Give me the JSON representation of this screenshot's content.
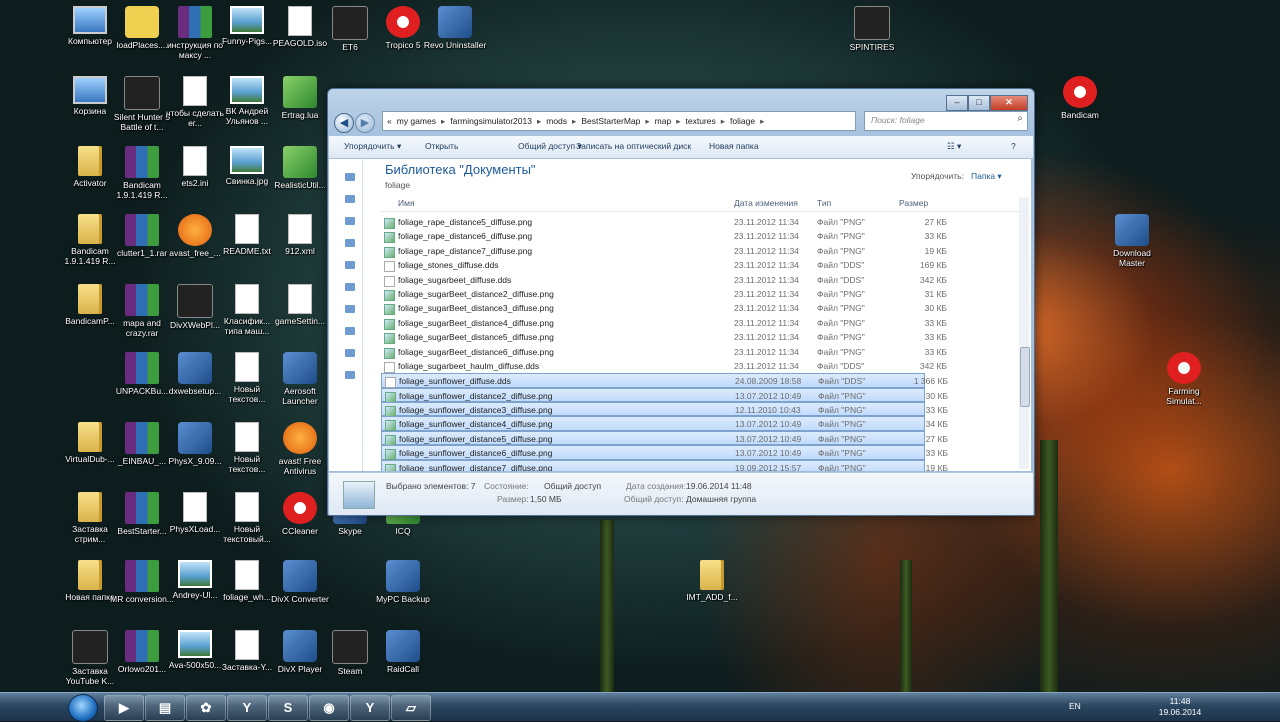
{
  "desktop_icons": [
    {
      "label": "Компьютер",
      "glyph": "comp"
    },
    {
      "label": "loadPlaces....",
      "glyph": "yellow"
    },
    {
      "label": "инструкция по максу ...",
      "glyph": "rar"
    },
    {
      "label": "Funny-Pigs...",
      "glyph": "img"
    },
    {
      "label": "PEAGOLD.iso",
      "glyph": "doc"
    },
    {
      "label": "ET6",
      "glyph": "dark"
    },
    {
      "label": "Tropico 5",
      "glyph": "red"
    },
    {
      "label": "Revo Uninstaller",
      "glyph": "app"
    },
    {
      "label": "SPINTIRES",
      "glyph": "dark"
    },
    {
      "label": "Корзина",
      "glyph": "comp"
    },
    {
      "label": "Silent Hunter 5 Battle of t...",
      "glyph": "dark"
    },
    {
      "label": "чтобы сделать ег...",
      "glyph": "doc"
    },
    {
      "label": "ВК Андрей Ульянов ...",
      "glyph": "img"
    },
    {
      "label": "Ertrag.lua",
      "glyph": "green"
    },
    {
      "label": "Bandicam",
      "glyph": "red"
    },
    {
      "label": "Activator",
      "glyph": "folder"
    },
    {
      "label": "Bandicam 1.9.1.419 R...",
      "glyph": "rar"
    },
    {
      "label": "ets2.ini",
      "glyph": "doc"
    },
    {
      "label": "Свинка.jpg",
      "glyph": "img"
    },
    {
      "label": "RealisticUtil...",
      "glyph": "green"
    },
    {
      "label": "Bandicam 1.9.1.419 R...",
      "glyph": "folder"
    },
    {
      "label": "clutter1_1.rar",
      "glyph": "rar"
    },
    {
      "label": "avast_free_...",
      "glyph": "orange"
    },
    {
      "label": "README.txt",
      "glyph": "doc"
    },
    {
      "label": "912.xml",
      "glyph": "doc"
    },
    {
      "label": "Download Master",
      "glyph": "app"
    },
    {
      "label": "BandicamP...",
      "glyph": "folder"
    },
    {
      "label": "mapa and crazy.rar",
      "glyph": "rar"
    },
    {
      "label": "DivXWebPl...",
      "glyph": "dark"
    },
    {
      "label": "Класифик... типа маш...",
      "glyph": "doc"
    },
    {
      "label": "gameSettin...",
      "glyph": "doc"
    },
    {
      "label": "UNPACKBu...",
      "glyph": "rar"
    },
    {
      "label": "dxwebsetup...",
      "glyph": "app"
    },
    {
      "label": "Новый текстов...",
      "glyph": "doc"
    },
    {
      "label": "Aerosoft Launcher",
      "glyph": "app"
    },
    {
      "label": "Farming Simulat...",
      "glyph": "red"
    },
    {
      "label": "VirtualDub-...",
      "glyph": "folder"
    },
    {
      "label": "_EINBAU_...",
      "glyph": "rar"
    },
    {
      "label": "PhysX_9.09...",
      "glyph": "app"
    },
    {
      "label": "Новый текстов...",
      "glyph": "doc"
    },
    {
      "label": "avast! Free Antivirus",
      "glyph": "orange"
    },
    {
      "label": "Заставка стрим...",
      "glyph": "folder"
    },
    {
      "label": "BestStarter...",
      "glyph": "rar"
    },
    {
      "label": "PhysXLoad...",
      "glyph": "doc"
    },
    {
      "label": "Новый текстовый...",
      "glyph": "doc"
    },
    {
      "label": "CCleaner",
      "glyph": "red"
    },
    {
      "label": "Skype",
      "glyph": "app"
    },
    {
      "label": "ICQ",
      "glyph": "green"
    },
    {
      "label": "Новая папка",
      "glyph": "folder"
    },
    {
      "label": "MR conversion...",
      "glyph": "rar"
    },
    {
      "label": "Andrey-Ul...",
      "glyph": "img"
    },
    {
      "label": "foliage_wh...",
      "glyph": "doc"
    },
    {
      "label": "DivX Converter",
      "glyph": "app"
    },
    {
      "label": "MyPC Backup",
      "glyph": "app"
    },
    {
      "label": "IMT_ADD_f...",
      "glyph": "folder"
    },
    {
      "label": "Заставка YouTube K...",
      "glyph": "dark"
    },
    {
      "label": "Orlowo201...",
      "glyph": "rar"
    },
    {
      "label": "Ava-500x50...",
      "glyph": "img"
    },
    {
      "label": "Заставка-Y...",
      "glyph": "doc"
    },
    {
      "label": "DivX Player",
      "glyph": "app"
    },
    {
      "label": "Steam",
      "glyph": "dark"
    },
    {
      "label": "RaidCall",
      "glyph": "app"
    }
  ],
  "explorer": {
    "back_glyph": "◀",
    "fwd_glyph": "▶",
    "address": {
      "prefix": "«",
      "parts": [
        "my games",
        "farmingsimulator2013",
        "mods",
        "BestStarterMap",
        "map",
        "textures",
        "foliage"
      ],
      "sep": "▸"
    },
    "refresh_glyph": "⟳",
    "search_placeholder": "Поиск: foliage",
    "search_glyph": "⌕",
    "caption_buttons": {
      "min": "–",
      "max": "□",
      "close": "✕"
    },
    "toolbar": {
      "organize": "Упорядочить ▾",
      "open": "Открыть",
      "share": "Общий доступ ▾",
      "burn": "Записать на оптический диск",
      "new_folder": "Новая папка",
      "view": "☷ ▾",
      "help": "?"
    },
    "library_title": "Библиотека \"Документы\"",
    "library_sub": "foliage",
    "arrange_label": "Упорядочить:",
    "arrange_value": "Папка ▾",
    "columns": {
      "name": "Имя",
      "date": "Дата изменения",
      "type": "Тип",
      "size": "Размер"
    },
    "files": [
      {
        "name": "foliage_rape_distance5_diffuse.png",
        "date": "23.11.2012 11:34",
        "type": "Файл \"PNG\"",
        "size": "27 КБ",
        "kind": "png",
        "selected": false
      },
      {
        "name": "foliage_rape_distance6_diffuse.png",
        "date": "23.11.2012 11:34",
        "type": "Файл \"PNG\"",
        "size": "33 КБ",
        "kind": "png",
        "selected": false
      },
      {
        "name": "foliage_rape_distance7_diffuse.png",
        "date": "23.11.2012 11:34",
        "type": "Файл \"PNG\"",
        "size": "19 КБ",
        "kind": "png",
        "selected": false
      },
      {
        "name": "foliage_stones_diffuse.dds",
        "date": "23.11.2012 11:34",
        "type": "Файл \"DDS\"",
        "size": "169 КБ",
        "kind": "dds",
        "selected": false
      },
      {
        "name": "foliage_sugarbeet_diffuse.dds",
        "date": "23.11.2012 11:34",
        "type": "Файл \"DDS\"",
        "size": "342 КБ",
        "kind": "dds",
        "selected": false
      },
      {
        "name": "foliage_sugarBeet_distance2_diffuse.png",
        "date": "23.11.2012 11:34",
        "type": "Файл \"PNG\"",
        "size": "31 КБ",
        "kind": "png",
        "selected": false
      },
      {
        "name": "foliage_sugarBeet_distance3_diffuse.png",
        "date": "23.11.2012 11:34",
        "type": "Файл \"PNG\"",
        "size": "30 КБ",
        "kind": "png",
        "selected": false
      },
      {
        "name": "foliage_sugarBeet_distance4_diffuse.png",
        "date": "23.11.2012 11:34",
        "type": "Файл \"PNG\"",
        "size": "33 КБ",
        "kind": "png",
        "selected": false
      },
      {
        "name": "foliage_sugarBeet_distance5_diffuse.png",
        "date": "23.11.2012 11:34",
        "type": "Файл \"PNG\"",
        "size": "33 КБ",
        "kind": "png",
        "selected": false
      },
      {
        "name": "foliage_sugarBeet_distance6_diffuse.png",
        "date": "23.11.2012 11:34",
        "type": "Файл \"PNG\"",
        "size": "33 КБ",
        "kind": "png",
        "selected": false
      },
      {
        "name": "foliage_sugarbeet_haulm_diffuse.dds",
        "date": "23.11.2012 11:34",
        "type": "Файл \"DDS\"",
        "size": "342 КБ",
        "kind": "dds",
        "selected": false
      },
      {
        "name": "foliage_sunflower_diffuse.dds",
        "date": "24.08.2009 18:58",
        "type": "Файл \"DDS\"",
        "size": "1 366 КБ",
        "kind": "dds",
        "selected": true
      },
      {
        "name": "foliage_sunflower_distance2_diffuse.png",
        "date": "13.07.2012 10:49",
        "type": "Файл \"PNG\"",
        "size": "30 КБ",
        "kind": "png",
        "selected": true
      },
      {
        "name": "foliage_sunflower_distance3_diffuse.png",
        "date": "12.11.2010 10:43",
        "type": "Файл \"PNG\"",
        "size": "33 КБ",
        "kind": "png",
        "selected": true
      },
      {
        "name": "foliage_sunflower_distance4_diffuse.png",
        "date": "13.07.2012 10:49",
        "type": "Файл \"PNG\"",
        "size": "34 КБ",
        "kind": "png",
        "selected": true
      },
      {
        "name": "foliage_sunflower_distance5_diffuse.png",
        "date": "13.07.2012 10:49",
        "type": "Файл \"PNG\"",
        "size": "27 КБ",
        "kind": "png",
        "selected": true
      },
      {
        "name": "foliage_sunflower_distance6_diffuse.png",
        "date": "13.07.2012 10:49",
        "type": "Файл \"PNG\"",
        "size": "33 КБ",
        "kind": "png",
        "selected": true
      },
      {
        "name": "foliage_sunflower_distance7_diffuse.png",
        "date": "19.09.2012 15:57",
        "type": "Файл \"PNG\"",
        "size": "19 КБ",
        "kind": "png",
        "selected": true
      }
    ],
    "details": {
      "selected": "Выбрано элементов: 7",
      "state_label": "Состояние:",
      "state_value": "Общий доступ",
      "size_label": "Размер:",
      "size_value": "1,50 МБ",
      "created_label": "Дата создания:",
      "created_value": "19.06.2014 11:48",
      "shared_label": "Общий доступ:",
      "shared_value": "Домашняя группа"
    }
  },
  "taskbar": {
    "buttons": [
      "▶",
      "▤",
      "✿",
      "Y",
      "S",
      "◉",
      "Y",
      "▱"
    ],
    "lang": "EN",
    "time": "11:48",
    "date": "19.06.2014"
  },
  "colors": {
    "selection": "#c1dbfc",
    "library_title": "#1e5b9a"
  }
}
